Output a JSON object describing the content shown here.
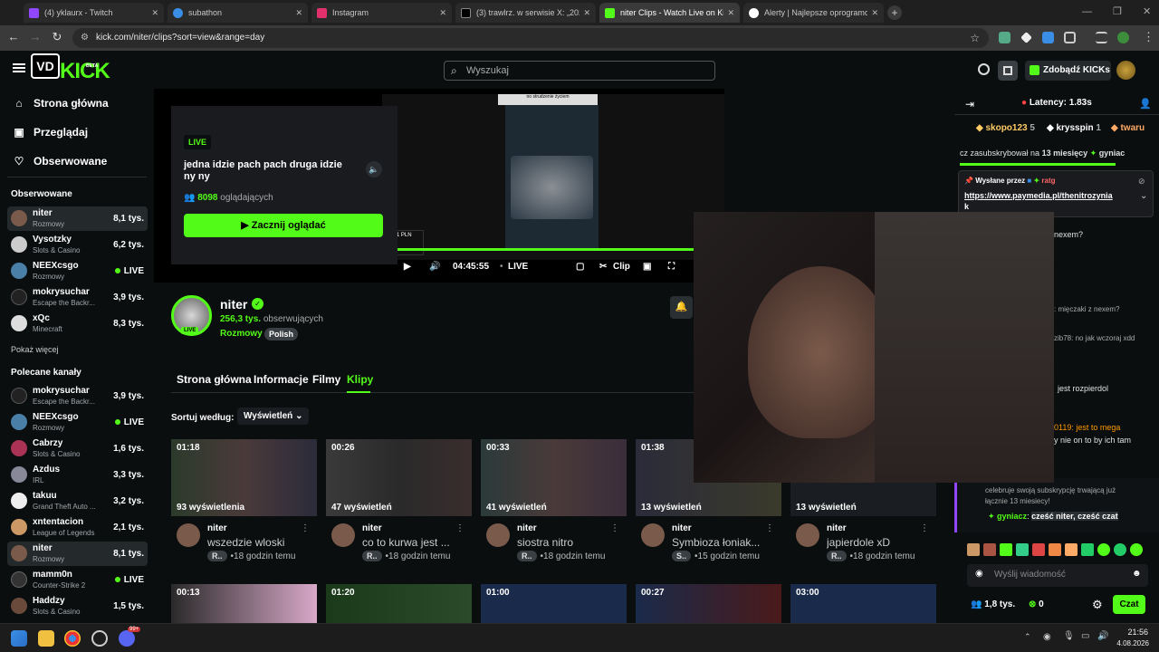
{
  "browser": {
    "tabs": [
      {
        "title": "(4) yklaurx - Twitch",
        "color": "#9146ff"
      },
      {
        "title": "subathon",
        "color": "#3a8ee6"
      },
      {
        "title": "Instagram",
        "color": "#e1306c"
      },
      {
        "title": "(3) trawlrz. w serwisie X: „2026/...",
        "color": "#000000"
      },
      {
        "title": "niter Clips - Watch Live on Kick",
        "color": "#53fc18"
      },
      {
        "title": "Alerty | Najlepsze oprogramow...",
        "color": "#ffffff"
      }
    ],
    "url": "kick.com/niter/clips?sort=view&range=day"
  },
  "header": {
    "logo_text": "KICK",
    "logo_badge": "VD",
    "beta": "BETA",
    "search_placeholder": "Wyszukaj",
    "kicks_button": "Zdobądź KICKs"
  },
  "sidebar": {
    "nav": [
      {
        "label": "Strona główna",
        "icon": "home-icon"
      },
      {
        "label": "Przeglądaj",
        "icon": "browse-icon"
      },
      {
        "label": "Obserwowane",
        "icon": "heart-icon"
      }
    ],
    "followed_title": "Obserwowane",
    "followed": [
      {
        "name": "niter",
        "category": "Rozmowy",
        "viewers": "8,1 tys."
      },
      {
        "name": "Vysotzky",
        "category": "Slots & Casino",
        "viewers": "6,2 tys."
      },
      {
        "name": "NEEXcsgo",
        "category": "Rozmowy",
        "viewers": "LIVE"
      },
      {
        "name": "mokrysuchar",
        "category": "Escape the Backr...",
        "viewers": "3,9 tys."
      },
      {
        "name": "xQc",
        "category": "Minecraft",
        "viewers": "8,3 tys."
      }
    ],
    "show_more": "Pokaż więcej",
    "recommended_title": "Polecane kanały",
    "recommended": [
      {
        "name": "mokrysuchar",
        "category": "Escape the Backr...",
        "viewers": "3,9 tys."
      },
      {
        "name": "NEEXcsgo",
        "category": "Rozmowy",
        "viewers": "LIVE"
      },
      {
        "name": "Cabrzy",
        "category": "Slots & Casino",
        "viewers": "1,6 tys."
      },
      {
        "name": "Azdus",
        "category": "IRL",
        "viewers": "3,3 tys."
      },
      {
        "name": "takuu",
        "category": "Grand Theft Auto ...",
        "viewers": "3,2 tys."
      },
      {
        "name": "xntentacion",
        "category": "League of Legends",
        "viewers": "2,1 tys."
      },
      {
        "name": "niter",
        "category": "Rozmowy",
        "viewers": "8,1 tys."
      },
      {
        "name": "mamm0n",
        "category": "Counter-Strike 2",
        "viewers": "LIVE"
      },
      {
        "name": "Haddzy",
        "category": "Slots & Casino",
        "viewers": "1,5 tys."
      }
    ]
  },
  "hero": {
    "live_badge": "LIVE",
    "title": "jedna idzie pach pach druga idzie ny ny",
    "viewers_count": "8098",
    "viewers_label": "oglądających",
    "watch_button": "Zacznij oglądać"
  },
  "player": {
    "time": "04:45:55",
    "live": "LIVE",
    "clip": "Clip",
    "top_caption": "no strudzenie życiem"
  },
  "channel": {
    "name": "niter",
    "followers_count": "256,3 tys.",
    "followers_label": "obserwujących",
    "category": "Rozmowy",
    "language": "Polish",
    "live": "LIVE"
  },
  "channel_tabs": [
    "Strona główna",
    "Informacje",
    "Filmy",
    "Klipy"
  ],
  "sort": {
    "label": "Sortuj według:",
    "value": "Wyświetleń"
  },
  "clips": [
    {
      "duration": "01:18",
      "views": "93 wyświetlenia",
      "channel": "niter",
      "title": "wszedzie wloski",
      "tag": "R..",
      "time": "18 godzin temu"
    },
    {
      "duration": "00:26",
      "views": "47 wyświetleń",
      "channel": "niter",
      "title": "co to kurwa jest ...",
      "tag": "R..",
      "time": "18 godzin temu"
    },
    {
      "duration": "00:33",
      "views": "41 wyświetleń",
      "channel": "niter",
      "title": "siostra nitro",
      "tag": "R..",
      "time": "18 godzin temu"
    },
    {
      "duration": "01:38",
      "views": "13 wyświetleń",
      "channel": "niter",
      "title": "Symbioza łoniak...",
      "tag": "S..",
      "time": "15 godzin temu"
    },
    {
      "duration": "",
      "views": "13 wyświetleń",
      "channel": "niter",
      "title": "japierdole xD",
      "tag": "R..",
      "time": "18 godzin temu"
    }
  ],
  "clips_row2": [
    "00:13",
    "01:20",
    "01:00",
    "00:27",
    "03:00"
  ],
  "chat": {
    "latency": "Latency: 1.83s",
    "top_gifters": [
      {
        "name": "skopo123",
        "count": "5"
      },
      {
        "name": "krysspin",
        "count": "1"
      },
      {
        "name": "twaru",
        "count": ""
      }
    ],
    "sub_line_prefix": "cz zasubskrybował na",
    "sub_months": "13 miesięcy",
    "sub_user": "gyniac",
    "pinned_label": "Wysłane przez",
    "pinned_user": "ratg",
    "pinned_link": "https://www.paymedia.pl/thenitrozynia",
    "pinned_link_tail": "k",
    "fragments": [
      "nexem?",
      ": mięczaki z nexem?",
      "zib78: no jak wczoraj xdd",
      "jest rozpierdol",
      "0119: jest to mega",
      "y nie on to by ich tam"
    ],
    "celebration": "celebruje swoją subskrypcję trwającą już łącznie 13 miesiecy!",
    "last_user": "gyniacz",
    "last_msg": "cześć niter, cześć czat",
    "input_placeholder": "Wyślij wiadomość",
    "viewer_count": "1,8 tys.",
    "kicks_count": "0",
    "chat_button": "Czat"
  },
  "taskbar": {
    "time": "21:56",
    "date": "4.08.2026",
    "badge": "99+"
  },
  "colors": {
    "accent": "#53fc18",
    "bg": "#0b0e0f",
    "panel": "#191b1f"
  }
}
